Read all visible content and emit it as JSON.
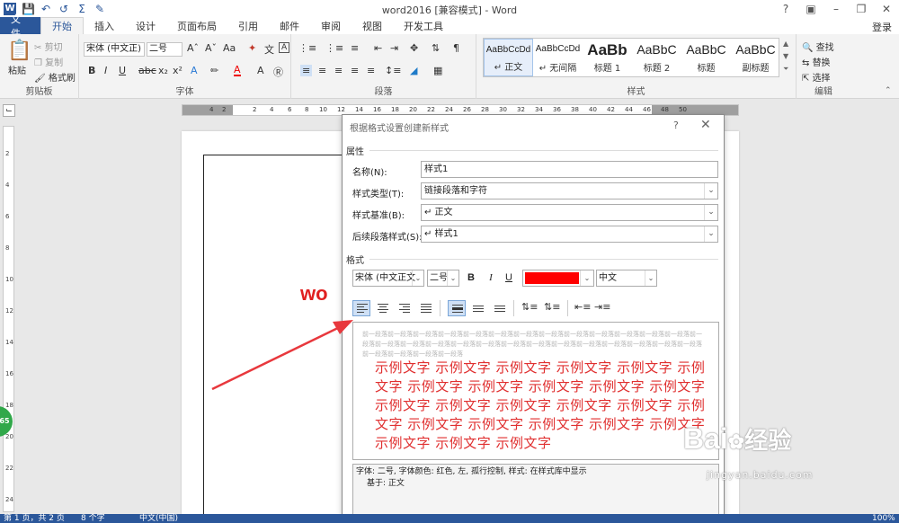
{
  "window": {
    "title": "word2016 [兼容模式] - Word",
    "login": "登录"
  },
  "tabs": [
    "文件",
    "开始",
    "插入",
    "设计",
    "页面布局",
    "引用",
    "邮件",
    "审阅",
    "视图",
    "开发工具"
  ],
  "ribbon": {
    "clipboard": {
      "paste": "粘贴",
      "cut": "剪切",
      "copy": "复制",
      "format_painter": "格式刷",
      "label": "剪贴板"
    },
    "font": {
      "name": "宋体 (中文正)",
      "size": "二号",
      "label": "字体"
    },
    "paragraph": {
      "label": "段落"
    },
    "styles": {
      "label": "样式",
      "items": [
        {
          "sample": "AaBbCcDd",
          "name": "↵ 正文"
        },
        {
          "sample": "AaBbCcDd",
          "name": "↵ 无间隔"
        },
        {
          "sample": "AaBb",
          "name": "标题 1"
        },
        {
          "sample": "AaBbC",
          "name": "标题 2"
        },
        {
          "sample": "AaBbC",
          "name": "标题"
        },
        {
          "sample": "AaBbC",
          "name": "副标题"
        }
      ]
    },
    "editing": {
      "find": "查找",
      "replace": "替换",
      "select": "选择",
      "label": "编辑"
    }
  },
  "ruler": {
    "h_ticks": [
      "4",
      "2",
      "2",
      "4",
      "6",
      "8",
      "10",
      "12",
      "14",
      "16",
      "18",
      "20",
      "22",
      "24",
      "26",
      "28",
      "30",
      "32",
      "34",
      "36",
      "38",
      "40",
      "42",
      "44",
      "46",
      "48",
      "50"
    ],
    "v_ticks": [
      "2",
      "4",
      "6",
      "8",
      "10",
      "12",
      "14",
      "16",
      "18",
      "20",
      "22",
      "24"
    ]
  },
  "document": {
    "visible_text": "wo"
  },
  "dialog": {
    "title": "根据格式设置创建新样式",
    "help": "?",
    "close": "✕",
    "properties_heading": "属性",
    "name_label": "名称(N):",
    "name_value": "样式1",
    "type_label": "样式类型(T):",
    "type_value": "链接段落和字符",
    "based_label": "样式基准(B):",
    "based_value": "↵ 正文",
    "follow_label": "后续段落样式(S):",
    "follow_value": "↵ 样式1",
    "format_heading": "格式",
    "font_name": "宋体 (中文正文",
    "font_size": "二号",
    "bold": "B",
    "italic": "I",
    "underline": "U",
    "font_color": "#ff0000",
    "script": "中文",
    "preview_prev": "前一段落前一段落前一段落前一段落前一段落前一段落前一段落前一段落前一段落前一段落前一段落前一段落前一段落前一段落前一段落前一段落前一段落前一段落前一段落前一段落前一段落前一段落前一段落前一段落前一段落前一段落前一段落前一段落前一段落前一段落前一段落",
    "preview_sample": "示例文字 示例文字 示例文字 示例文字 示例文字 示例文字 示例文字 示例文字 示例文字 示例文字 示例文字 示例文字 示例文字 示例文字 示例文字 示例文字 示例文字 示例文字 示例文字 示例文字 示例文字 示例文字 示例文字 示例文字 示例文字",
    "description_line1": "字体: 二号, 字体颜色: 红色, 左, 孤行控制, 样式: 在样式库中显示",
    "description_line2": "基于: 正文"
  },
  "statusbar": {
    "page": "第 1 页，共 2 页",
    "words": "8 个字",
    "lang": "中文(中国)",
    "zoom": "100%"
  },
  "badge": "65",
  "watermark": {
    "brand": "Bai",
    "brand2": "经验",
    "url": "jingyan.baidu.com"
  },
  "colors": {
    "accent": "#2b579a",
    "red": "#e03030"
  }
}
